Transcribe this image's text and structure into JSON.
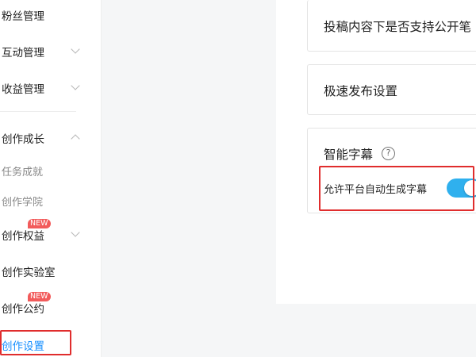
{
  "sidebar": {
    "items": [
      {
        "label": "粉丝管理"
      },
      {
        "label": "互动管理"
      },
      {
        "label": "收益管理"
      },
      {
        "label": "创作成长"
      },
      {
        "label": "任务成就"
      },
      {
        "label": "创作学院"
      },
      {
        "label": "创作权益",
        "badge": "NEW"
      },
      {
        "label": "创作实验室"
      },
      {
        "label": "创作公约",
        "badge": "NEW"
      },
      {
        "label": "创作设置"
      }
    ]
  },
  "main": {
    "cards": [
      {
        "title": "投稿内容下是否支持公开笔"
      },
      {
        "title": "极速发布设置"
      },
      {
        "title": "智能字幕",
        "help": "?",
        "toggle": {
          "label": "允许平台自动生成字幕",
          "on": true
        }
      }
    ]
  },
  "colors": {
    "accent": "#1890ff",
    "toggle_on": "#2fb0ee",
    "badge": "#f25b5b",
    "highlight": "#e02d2d"
  }
}
